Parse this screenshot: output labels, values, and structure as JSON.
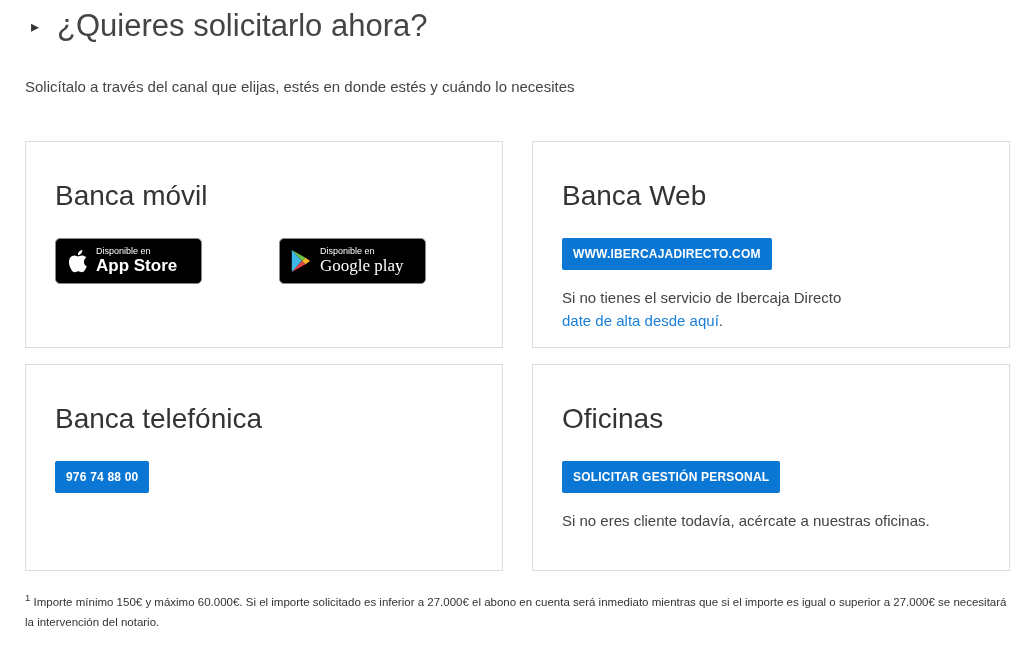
{
  "heading": {
    "marker": "▸",
    "title": "¿Quieres solicitarlo ahora?"
  },
  "intro": "Solicítalo a través del canal que elijas, estés en donde estés y cuándo lo necesites",
  "cards": [
    {
      "title": "Banca móvil",
      "kind": "stores",
      "badges": [
        {
          "kind": "apple",
          "small": "Disponible en",
          "big": "App Store"
        },
        {
          "kind": "google",
          "small": "Disponible en",
          "big": "Google play"
        }
      ]
    },
    {
      "title": "Banca Web",
      "kind": "action",
      "button": "WWW.IBERCAJADIRECTO.COM",
      "text": "Si no tienes el servicio de Ibercaja Directo",
      "link": "date de alta desde aquí",
      "after": "."
    },
    {
      "title": "Banca telefónica",
      "kind": "action",
      "button": "976 74 88 00"
    },
    {
      "title": "Oficinas",
      "kind": "action",
      "button": "SOLICITAR GESTIÓN PERSONAL",
      "text": "Si no eres cliente todavía, acércate a nuestras oficinas."
    }
  ],
  "footnote": "$^{1}$ Importe mínimo 150€ y máximo 60.000€. Si el importe solicitado es inferior a 27.000€ el abono en cuenta será inmediato mientras que si el importe es igual o superior a 27.000€ se necesitará la intervención del notario."
}
